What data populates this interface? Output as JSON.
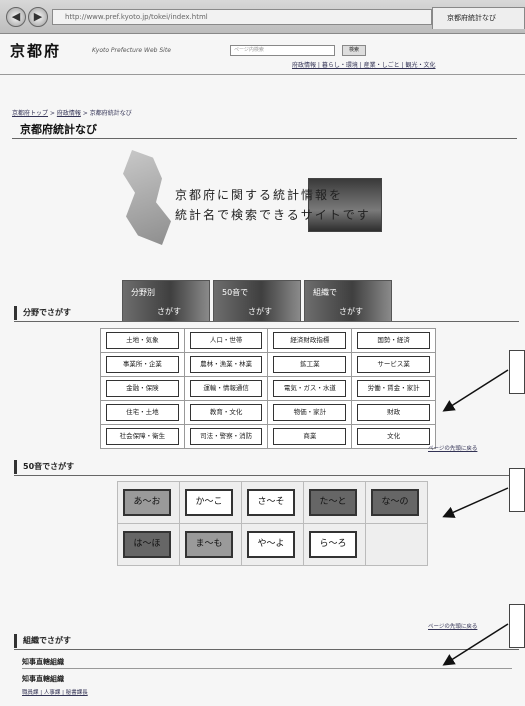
{
  "browser": {
    "url": "http://www.pref.kyoto.jp/tokei/index.html",
    "tab_title": "京都府統計なび",
    "back_icon": "back-arrow-icon",
    "forward_icon": "forward-arrow-icon"
  },
  "header": {
    "logo": "京都府",
    "logo_sub": "Kyoto Prefecture Web Site",
    "search_placeholder": "ページ内検索",
    "search_button": "検索",
    "links": "府政情報 | 暮らし・環境 | 産業・しごと | 観光・文化"
  },
  "breadcrumb": {
    "home": "京都府トップ",
    "parent": "府政情報",
    "current": "京都府統計なび"
  },
  "page_title": "京都府統計なび",
  "banner": {
    "line1": "京都府に関する統計情報を",
    "line2": "統計名で検索できるサイトです"
  },
  "feature_buttons": [
    {
      "label": "分野別",
      "sub": "さがす"
    },
    {
      "label": "50音で",
      "sub": "さがす"
    },
    {
      "label": "組織で",
      "sub": "さがす"
    }
  ],
  "sections": {
    "field": "分野でさがす",
    "kana": "50音でさがす",
    "org": "組織でさがす"
  },
  "field_categories": [
    [
      "土地・気象",
      "人口・世帯",
      "経済財政指標",
      "国勢・経済"
    ],
    [
      "事業所・企業",
      "農林・漁業・林業",
      "鉱工業",
      "サービス業"
    ],
    [
      "金融・保険",
      "運輸・情報通信",
      "電気・ガス・水道",
      "労働・賃金・家計"
    ],
    [
      "住宅・土地",
      "教育・文化",
      "物価・家計",
      "財政"
    ],
    [
      "社会保障・衛生",
      "司法・警察・消防",
      "商業",
      "文化"
    ]
  ],
  "kana_rows": [
    [
      {
        "label": "あ〜お",
        "tone": "mid"
      },
      {
        "label": "か〜こ",
        "tone": "light"
      },
      {
        "label": "さ〜そ",
        "tone": "light"
      },
      {
        "label": "た〜と",
        "tone": "dark"
      },
      {
        "label": "な〜の",
        "tone": "dark"
      }
    ],
    [
      {
        "label": "は〜ほ",
        "tone": "dark"
      },
      {
        "label": "ま〜も",
        "tone": "mid"
      },
      {
        "label": "や〜よ",
        "tone": "light"
      },
      {
        "label": "ら〜ろ",
        "tone": "light"
      }
    ]
  ],
  "page_top_link": "ページの先頭に戻る",
  "org": {
    "title": "知事直轄組織",
    "sub": "知事直轄組織",
    "links": "職員課 | 人事課 | 秘書課長"
  }
}
